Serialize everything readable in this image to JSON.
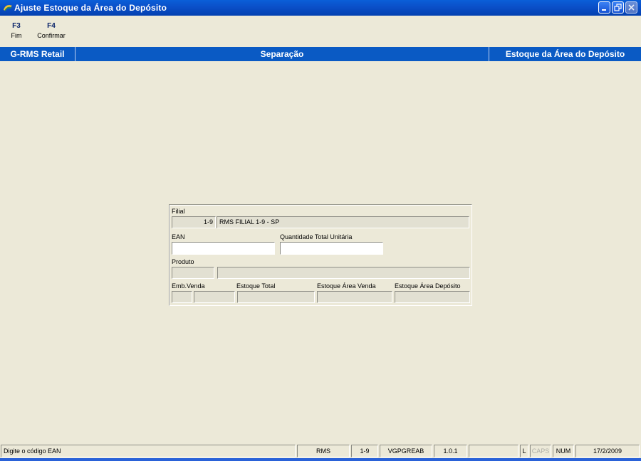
{
  "window": {
    "title": "Ajuste Estoque da Área do Depósito"
  },
  "fkeys": [
    {
      "key": "F3",
      "label": "Fim"
    },
    {
      "key": "F4",
      "label": "Confirmar"
    }
  ],
  "header": {
    "system": "G-RMS Retail",
    "module": "Separação",
    "screen": "Estoque da Área do Depósito"
  },
  "form": {
    "filial": {
      "label": "Filial",
      "code": "1-9",
      "name": "RMS FILIAL 1-9 - SP"
    },
    "ean": {
      "label": "EAN",
      "value": ""
    },
    "quantidade": {
      "label": "Quantidade Total Unitária",
      "value": ""
    },
    "produto": {
      "label": "Produto",
      "code": "",
      "description": ""
    },
    "emb_venda": {
      "label": "Emb.Venda",
      "unit": "",
      "qty": ""
    },
    "estoque_total": {
      "label": "Estoque Total",
      "value": ""
    },
    "estoque_area_venda": {
      "label": "Estoque Área Venda",
      "value": ""
    },
    "estoque_area_deposito": {
      "label": "Estoque Área Depósito",
      "value": ""
    }
  },
  "statusbar": {
    "message": "Digite o código EAN",
    "system": "RMS",
    "filial": "1-9",
    "program": "VGPGREAB",
    "version": "1.0.1",
    "blank": "",
    "lock": "L",
    "caps": "CAPS",
    "num": "NUM",
    "date": "17/2/2009"
  },
  "colors": {
    "title_bar": "#0A4FC8",
    "header_bar": "#0A5AC4",
    "background": "#ECE9D8",
    "key_text": "#0A246A"
  },
  "icons": {
    "app": "app-logo-icon",
    "minimize": "minimize-icon",
    "restore": "restore-icon",
    "close": "close-icon"
  }
}
